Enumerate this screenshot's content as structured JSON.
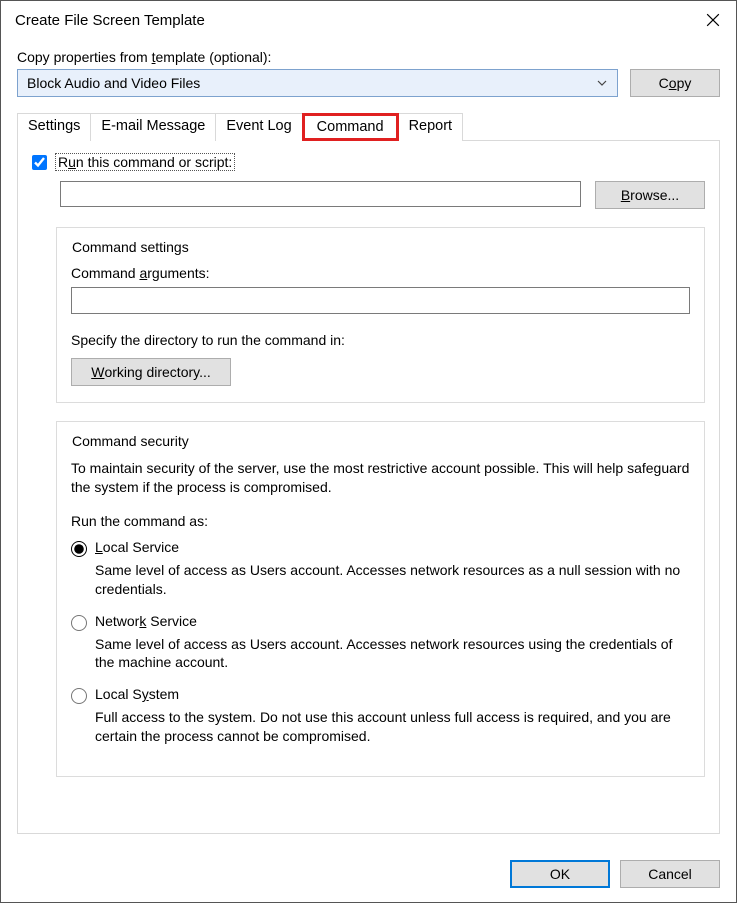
{
  "window": {
    "title": "Create File Screen Template"
  },
  "copySection": {
    "label_pre": "Copy properties from ",
    "label_u": "t",
    "label_post": "emplate (optional):",
    "selected": "Block Audio and Video Files",
    "copy_btn_pre": "C",
    "copy_btn_u": "o",
    "copy_btn_post": "py"
  },
  "tabs": {
    "settings": "Settings",
    "email": "E-mail Message",
    "eventlog": "Event Log",
    "command": "Command",
    "report": "Report"
  },
  "command": {
    "chk_pre": "R",
    "chk_u": "u",
    "chk_post": "n this command or script:",
    "browse_u": "B",
    "browse_post": "rowse...",
    "cmd_value": ""
  },
  "cmdSettings": {
    "legend": "Command settings",
    "args_pre": "Command ",
    "args_u": "a",
    "args_post": "rguments:",
    "args_value": "",
    "dir_hint": "Specify the directory to run the command in:",
    "wd_u": "W",
    "wd_post": "orking directory..."
  },
  "security": {
    "legend": "Command security",
    "desc": "To maintain security of the server, use the most restrictive account possible. This will help safeguard the system if the process is compromised.",
    "run_as": "Run the command as:",
    "opts": [
      {
        "u": "L",
        "post": "ocal Service",
        "desc": "Same level of access as Users account. Accesses network resources as a null session with no credentials."
      },
      {
        "pre": "Networ",
        "u": "k",
        "post": " Service",
        "desc": "Same level of access as Users account. Accesses network resources using the credentials of the machine account."
      },
      {
        "pre": "Local S",
        "u": "y",
        "post": "stem",
        "desc": "Full access to the system. Do not use this account unless full access is required, and you are certain the process cannot be compromised."
      }
    ]
  },
  "footer": {
    "ok": "OK",
    "cancel": "Cancel"
  }
}
